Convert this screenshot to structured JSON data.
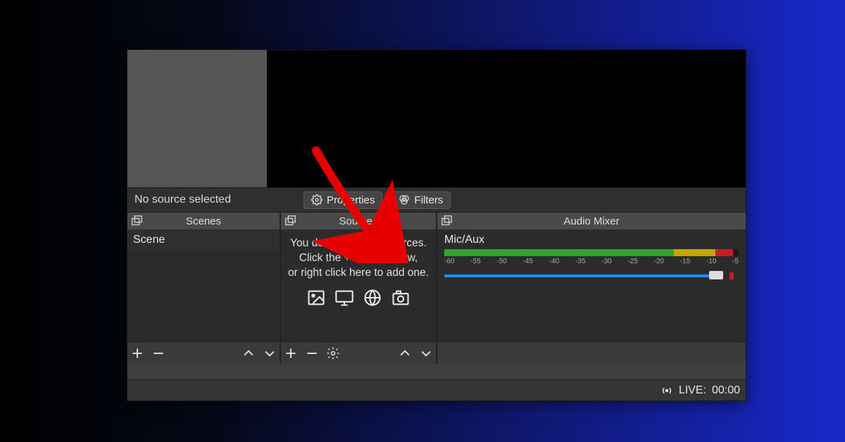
{
  "toolbar": {
    "status_text": "No source selected",
    "properties_label": "Properties",
    "filters_label": "Filters"
  },
  "panels": {
    "scenes": {
      "title": "Scenes",
      "items": [
        "Scene"
      ]
    },
    "sources": {
      "title": "Sources",
      "empty_line1": "You don't have any sources.",
      "empty_line2": "Click the + button below,",
      "empty_line3": "or right click here to add one."
    },
    "mixer": {
      "title": "Audio Mixer",
      "channel_name": "Mic/Aux",
      "scale": [
        "-60",
        "-55",
        "-50",
        "-45",
        "-40",
        "-35",
        "-30",
        "-25",
        "-20",
        "-15",
        "-10",
        "-5"
      ],
      "meter": {
        "green_pct": 78,
        "yellow_pct": 14,
        "red_pct": 6
      },
      "slider": {
        "value_pct": 92
      }
    }
  },
  "status": {
    "live_label": "LIVE:",
    "live_time": "00:00"
  },
  "icons": {
    "popout": "popout-icon",
    "gear": "gear-icon",
    "filter": "filter-icon",
    "plus": "plus-icon",
    "minus": "minus-icon",
    "chevron_up": "chevron-up-icon",
    "chevron_down": "chevron-down-icon",
    "image": "image-icon",
    "display": "display-icon",
    "globe": "globe-icon",
    "camera": "camera-icon",
    "broadcast": "broadcast-icon"
  },
  "colors": {
    "accent_red_arrow": "#e60000",
    "meter_green": "#2fa52a",
    "meter_yellow": "#c8a500",
    "meter_red": "#c81e1e",
    "slider_blue": "#1e8fff"
  }
}
